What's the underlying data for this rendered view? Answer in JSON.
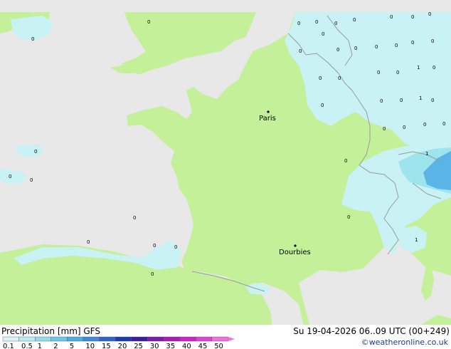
{
  "map": {
    "cities": [
      {
        "name": "Paris"
      },
      {
        "name": "Dourbies"
      }
    ],
    "values": [
      "0",
      "0",
      "0",
      "0",
      "0",
      "0",
      "0",
      "0",
      "0",
      "0",
      "0",
      "0",
      "0",
      "0",
      "0",
      "0",
      "0",
      "0",
      "0",
      "1",
      "0",
      "0",
      "0",
      "0",
      "0",
      "1",
      "0",
      "0",
      "0",
      "0",
      "0",
      "1",
      "0",
      "0",
      "0",
      "0",
      "0",
      "0",
      "0",
      "0",
      "0",
      "0",
      "0",
      "1"
    ],
    "colors": {
      "land": "#c4f09a",
      "sea": "#e8e8e8",
      "precip_light": "#c8f2f4",
      "precip_mid": "#9ee4ee",
      "precip_heavy": "#5ab4e6",
      "border": "#9a9a9a"
    }
  },
  "footer": {
    "title": "Precipitation [mm]  GFS",
    "datetime": "Su 19-04-2026 06..09 UTC (00+249)",
    "credit": "©weatheronline.co.uk",
    "scale_labels": [
      "0.1",
      "0.5",
      "1",
      "2",
      "5",
      "10",
      "15",
      "20",
      "25",
      "30",
      "35",
      "40",
      "45",
      "50"
    ],
    "scale_colors": [
      "#d8f4f6",
      "#b4ecf2",
      "#8edcec",
      "#6cc8e8",
      "#4aaee4",
      "#3c8ad8",
      "#2c64c8",
      "#1c3cb4",
      "#3c1c9c",
      "#7c1ca8",
      "#b018b8",
      "#d020c8",
      "#e440d4",
      "#f070e0"
    ]
  }
}
